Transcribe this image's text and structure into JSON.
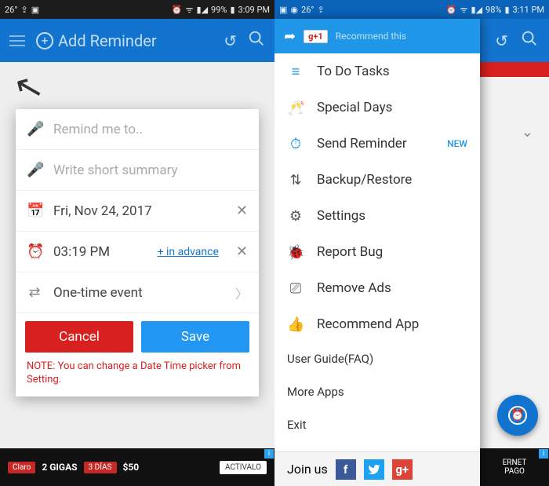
{
  "left": {
    "statusbar": {
      "temp": "26°",
      "dropbox": "⇪",
      "camera": "▣",
      "alarm": "⏰",
      "wifi": "ᯤ",
      "signal": "▮◢",
      "battery_pct": "99%",
      "battery": "▮",
      "time": "3:09 PM"
    },
    "appbar": {
      "title": "Add Reminder"
    },
    "dialog": {
      "remind_placeholder": "Remind me to..",
      "summary_placeholder": "Write short summary",
      "date": "Fri, Nov 24, 2017",
      "time": "03:19 PM",
      "advance_link": "+ in advance",
      "repeat": "One-time event",
      "cancel": "Cancel",
      "save": "Save",
      "note": "NOTE: You can change a Date Time picker from Setting."
    },
    "ad": {
      "brand": "Claro",
      "text": "2 GIGAS",
      "days": "3 DÍAS",
      "price": "$50",
      "cta": "ACTIVALO"
    }
  },
  "right": {
    "statusbar": {
      "pic": "▣",
      "cam": "◉",
      "temp": "26°",
      "dropbox": "⇪",
      "alarm": "⏰",
      "wifi": "ᯤ",
      "signal": "▮◢",
      "battery_pct": "98%",
      "battery": "▮",
      "time": "3:11 PM"
    },
    "drawer": {
      "gplus": "g+1",
      "recommend": "Recommend this",
      "items": [
        {
          "icon": "≡",
          "label": "To Do Tasks",
          "blue": true
        },
        {
          "icon": "🥂",
          "label": "Special Days",
          "blue": true
        },
        {
          "icon": "⏱",
          "label": "Send Reminder",
          "blue": true,
          "badge": "NEW"
        },
        {
          "icon": "⇅",
          "label": "Backup/Restore"
        },
        {
          "icon": "⚙",
          "label": "Settings"
        },
        {
          "icon": "🐞",
          "label": "Report Bug"
        },
        {
          "icon": "⎚",
          "label": "Remove Ads"
        },
        {
          "icon": "👍",
          "label": "Recommend App"
        }
      ],
      "subitems": [
        "User Guide(FAQ)",
        "More Apps",
        "Exit"
      ],
      "join": "Join us"
    },
    "ad": {
      "l1": "ERNET",
      "l2": "PAGO"
    }
  }
}
